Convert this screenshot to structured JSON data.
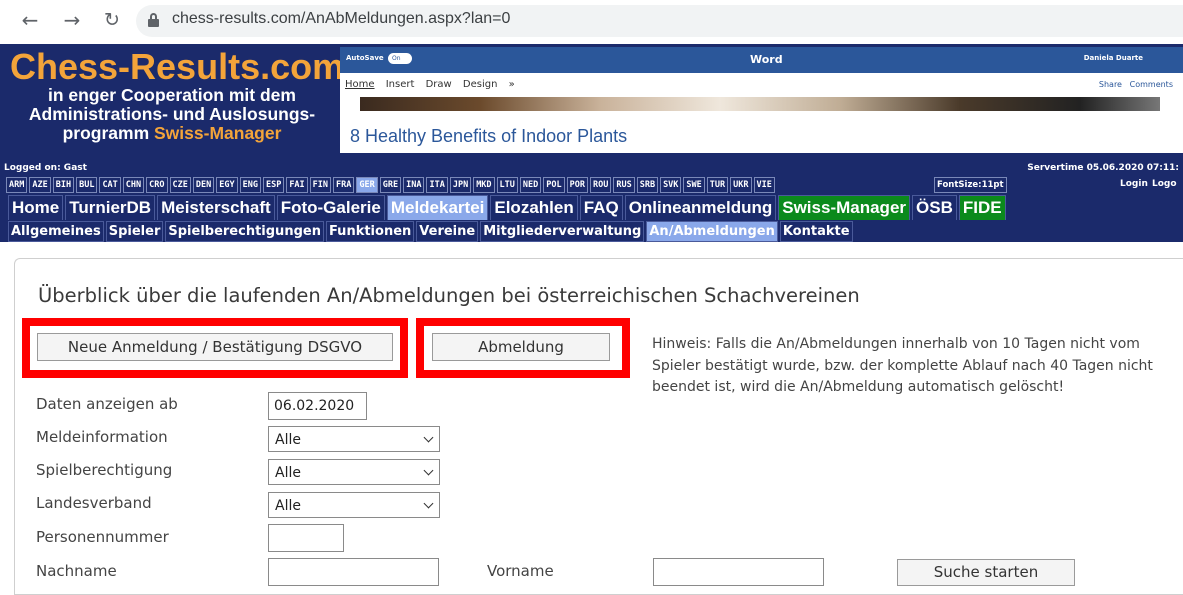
{
  "browser": {
    "url": "chess-results.com/AnAbMeldungen.aspx?lan=0",
    "back_icon": "arrow-left",
    "forward_icon": "arrow-right",
    "reload_icon": "reload"
  },
  "header": {
    "logo_title": "Chess-Results.com",
    "logo_line1": "in enger Cooperation mit dem",
    "logo_line2": "Administrations- und Auslosungs-",
    "logo_line3_pre": "programm ",
    "logo_line3_highlight": "Swiss-Manager",
    "colors": {
      "background": "#1b2a6b",
      "logo": "#f3a43a",
      "active": "#8aa8ea",
      "green": "#0b8a1c"
    }
  },
  "ad": {
    "autosave": "AutoSave",
    "toggle": "On",
    "app": "Word",
    "user": "Daniela Duarte",
    "tabs": [
      "Home",
      "Insert",
      "Draw",
      "Design",
      "»"
    ],
    "share": "Share",
    "comments": "Comments",
    "headline": "8 Healthy Benefits of Indoor Plants"
  },
  "status": {
    "logged_on": "Logged on: Gast",
    "servertime": "Servertime 05.06.2020 07:11:"
  },
  "languages": [
    "ARM",
    "AZE",
    "BIH",
    "BUL",
    "CAT",
    "CHN",
    "CRO",
    "CZE",
    "DEN",
    "EGY",
    "ENG",
    "ESP",
    "FAI",
    "FIN",
    "FRA",
    "GER",
    "GRE",
    "INA",
    "ITA",
    "JPN",
    "MKD",
    "LTU",
    "NED",
    "POL",
    "POR",
    "ROU",
    "RUS",
    "SRB",
    "SVK",
    "SWE",
    "TUR",
    "UKR",
    "VIE"
  ],
  "active_language": "GER",
  "fontsize": "FontSize:11pt",
  "login": "Login",
  "logout": "Logo",
  "mainnav": [
    {
      "label": "Home",
      "style": ""
    },
    {
      "label": "TurnierDB",
      "style": ""
    },
    {
      "label": "Meisterschaft",
      "style": ""
    },
    {
      "label": "Foto-Galerie",
      "style": ""
    },
    {
      "label": "Meldekartei",
      "style": "active"
    },
    {
      "label": "Elozahlen",
      "style": ""
    },
    {
      "label": "FAQ",
      "style": ""
    },
    {
      "label": "Onlineanmeldung",
      "style": ""
    },
    {
      "label": "Swiss-Manager",
      "style": "green"
    },
    {
      "label": "ÖSB",
      "style": ""
    },
    {
      "label": "FIDE",
      "style": "green"
    }
  ],
  "subnav": [
    {
      "label": "Allgemeines",
      "active": false
    },
    {
      "label": "Spieler",
      "active": false
    },
    {
      "label": "Spielberechtigungen",
      "active": false
    },
    {
      "label": "Funktionen",
      "active": false
    },
    {
      "label": "Vereine",
      "active": false
    },
    {
      "label": "Mitgliederverwaltung",
      "active": false
    },
    {
      "label": "An/Abmeldungen",
      "active": true
    },
    {
      "label": "Kontakte",
      "active": false
    }
  ],
  "main": {
    "title": "Überblick über die laufenden An/Abmeldungen bei österreichischen Schachvereinen",
    "new_registration_button": "Neue Anmeldung / Bestätigung DSGVO",
    "deregistration_button": "Abmeldung",
    "hint": "Hinweis: Falls die An/Abmeldungen innerhalb von 10 Tagen nicht vom Spieler bestätigt wurde, bzw. der komplette Ablauf nach 40 Tagen nicht beendet ist, wird die An/Abmeldung automatisch gelöscht!",
    "form": {
      "date_label": "Daten anzeigen ab",
      "date_value": "06.02.2020",
      "meldeinfo_label": "Meldeinformation",
      "meldeinfo_value": "Alle",
      "spielber_label": "Spielberechtigung",
      "spielber_value": "Alle",
      "landesverband_label": "Landesverband",
      "landesverband_value": "Alle",
      "personennummer_label": "Personennummer",
      "personennummer_value": "",
      "nachname_label": "Nachname",
      "nachname_value": "",
      "vorname_label": "Vorname",
      "vorname_value": "",
      "search_button": "Suche starten"
    },
    "highlight_color": "#ff0000"
  }
}
